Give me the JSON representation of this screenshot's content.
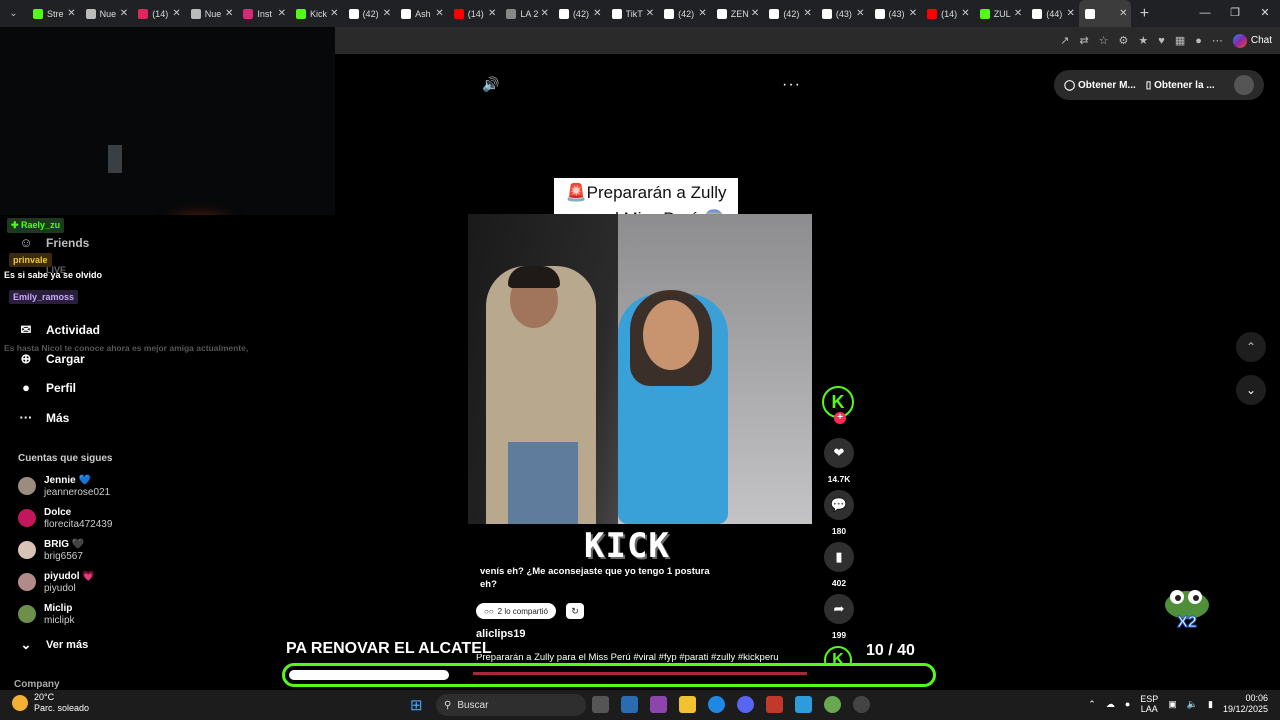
{
  "browser": {
    "tabs": [
      {
        "label": "Stre",
        "color": "#53fc18"
      },
      {
        "label": "Nue",
        "color": "#bbbbbb"
      },
      {
        "label": "(14)",
        "color": "#e0245e"
      },
      {
        "label": "Nue",
        "color": "#bbbbbb"
      },
      {
        "label": "Inst",
        "color": "#d62976"
      },
      {
        "label": "Kick",
        "color": "#53fc18"
      },
      {
        "label": "(42)",
        "color": "#ffffff"
      },
      {
        "label": "Ash",
        "color": "#ffffff"
      },
      {
        "label": "(14)",
        "color": "#ff0000"
      },
      {
        "label": "LA 2",
        "color": "#888888"
      },
      {
        "label": "(42)",
        "color": "#ffffff"
      },
      {
        "label": "TikT",
        "color": "#ffffff"
      },
      {
        "label": "(42)",
        "color": "#ffffff"
      },
      {
        "label": "ZEN",
        "color": "#ffffff"
      },
      {
        "label": "(42)",
        "color": "#ffffff"
      },
      {
        "label": "(43)",
        "color": "#ffffff"
      },
      {
        "label": "(43)",
        "color": "#ffffff"
      },
      {
        "label": "(14)",
        "color": "#ff0000"
      },
      {
        "label": "ZUL",
        "color": "#53fc18"
      },
      {
        "label": "(44)",
        "color": "#ffffff"
      },
      {
        "label": "",
        "color": "#ffffff"
      }
    ],
    "chat_label": "Chat"
  },
  "sidebar": {
    "items": [
      {
        "label": "Friends",
        "icon": "friends-icon",
        "glyph": "☺"
      },
      {
        "label": "Actividad",
        "icon": "activity-icon",
        "glyph": "✉"
      },
      {
        "label": "Cargar",
        "icon": "upload-icon",
        "glyph": "⊕"
      },
      {
        "label": "Perfil",
        "icon": "profile-icon",
        "glyph": "●"
      },
      {
        "label": "Más",
        "icon": "more-icon",
        "glyph": "···"
      }
    ],
    "live_label": "LIVE",
    "follows_title": "Cuentas que sigues",
    "accounts": [
      {
        "name": "Jennie 💙",
        "handle": "jeannerose021",
        "color": "#9a8c7e"
      },
      {
        "name": "Dolce",
        "handle": "florecita472439",
        "color": "#c2185b"
      },
      {
        "name": "BRIG 🖤",
        "handle": "brig6567",
        "color": "#d9c3b5"
      },
      {
        "name": "piyudol 💗",
        "handle": "piyudol",
        "color": "#b28a8a"
      },
      {
        "name": "Miclip",
        "handle": "miclipk",
        "color": "#6c8f4a"
      }
    ],
    "see_more": "Ver más",
    "company": "Company"
  },
  "chat_overlay": {
    "user1": "✚ Raely_zu",
    "user2": "prinvale",
    "msg1": "Es si sabe ya se olvido",
    "user3": "Emily_ramoss",
    "msg2": "Es hasta Nicol te conoce ahora es mejor amiga actualmente,"
  },
  "player": {
    "menu_dots": "···",
    "pill_btn1": "Obtener M...",
    "pill_btn2": "Obtener la ...",
    "caption": "🚨Prepararán a Zully para el Miss Perú 😱",
    "kick_logo": "KICK",
    "description": "venís eh? ¿Me aconsejaste que yo tengo 1 postura eh?",
    "shared": "2 lo compartió",
    "author": "aliclips19",
    "tags": "Prepararán a Zully para el Miss Perú #viral #fyp #parati #zully #kickperu",
    "likes": "14.7K",
    "comments": "180",
    "saves": "402",
    "shares": "199"
  },
  "stream_overlay": {
    "title": "PA RENOVAR EL ALCATEL",
    "counter": "10 / 40",
    "progress": 0.25,
    "multiplier": "X2"
  },
  "taskbar": {
    "temp": "20°C",
    "weather": "Parc. soleado",
    "search": "Buscar",
    "lang1": "ESP",
    "lang2": "LAA",
    "time": "00:06",
    "date": "19/12/2025"
  }
}
